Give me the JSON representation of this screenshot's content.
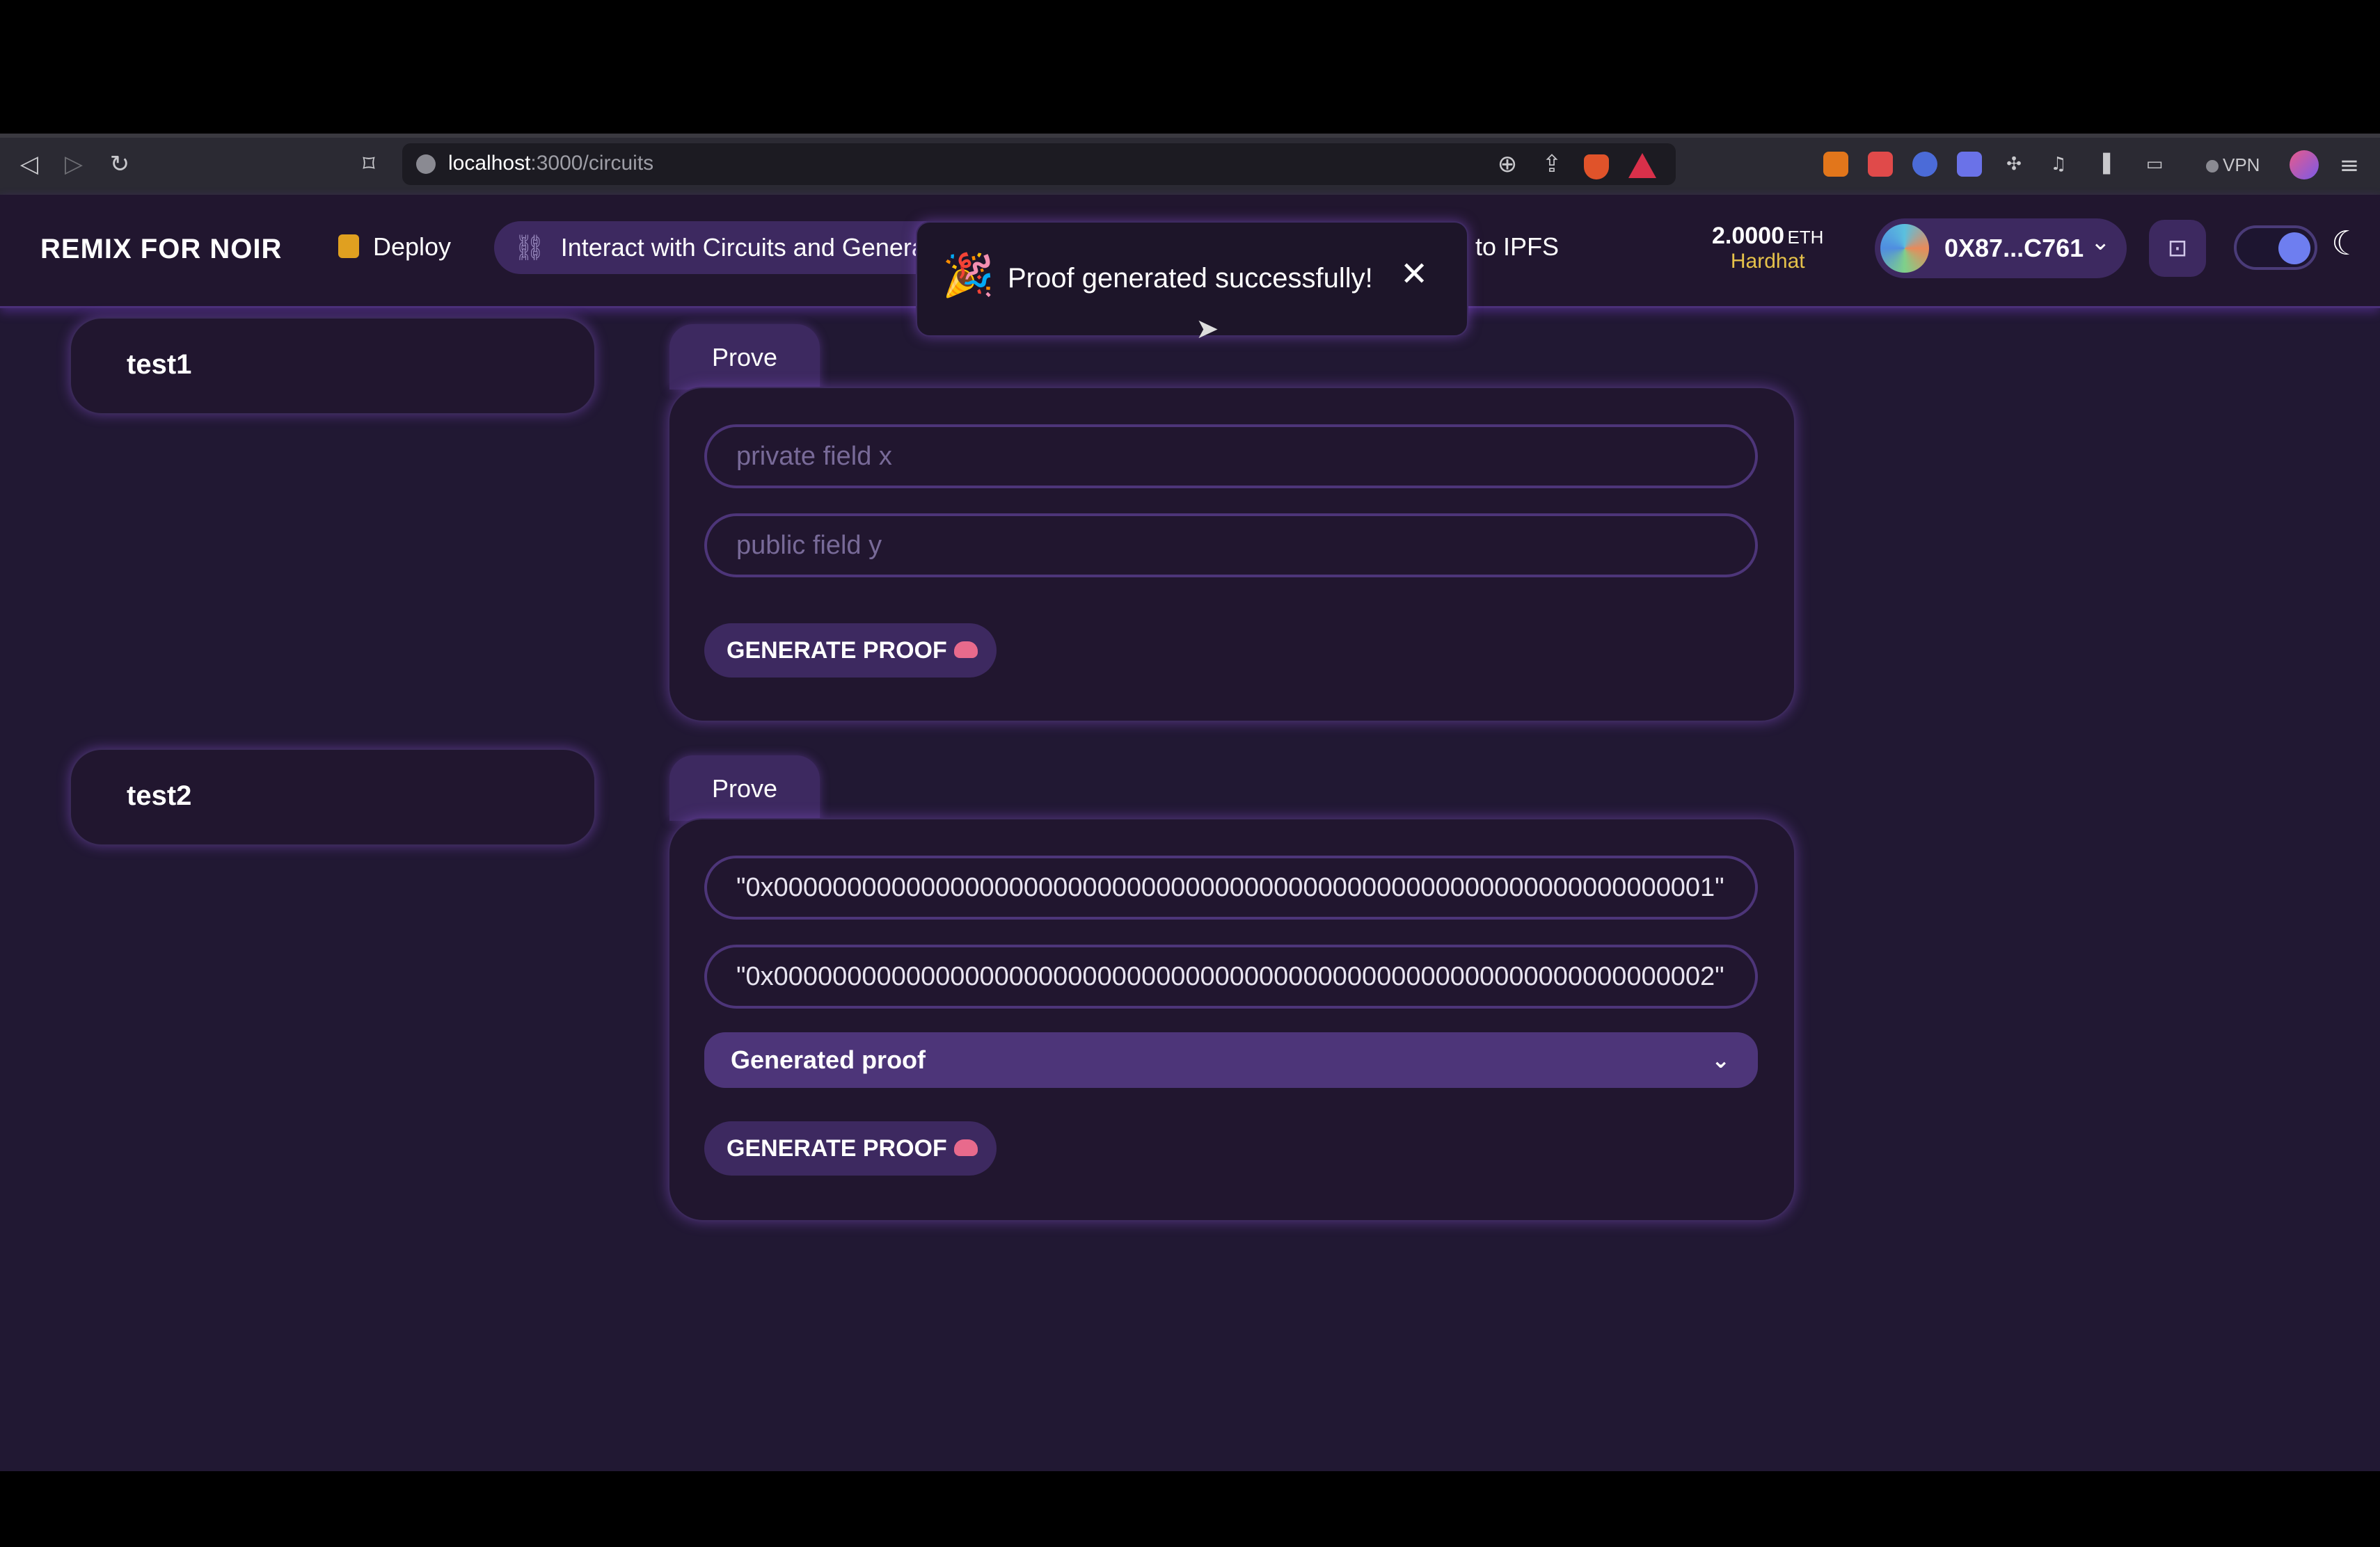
{
  "browser": {
    "back_icon": "◁",
    "forward_icon": "▷",
    "reload_icon": "↻",
    "bookmark_icon": "⌑",
    "url_host": "localhost",
    "url_path": ":3000/circuits",
    "zoom_icon": "⊕",
    "share_icon": "⇪",
    "vpn_label": "VPN",
    "menu_icon": "≡"
  },
  "navbar": {
    "brand": "REMIX FOR NOIR",
    "deploy_label": "Deploy",
    "interact_label": "Interact with Circuits and Generate Proofs",
    "interact_icon": "⛓",
    "ipfs_label": "d to IPFS",
    "balance_amount": "2.0000",
    "balance_unit": "ETH",
    "network": "Hardhat",
    "wallet_address": "0X87...C761",
    "wallet_chevron": "⌄",
    "qr_icon": "⊡",
    "moon_icon": "☾"
  },
  "toast": {
    "icon": "🎉",
    "message": "Proof generated successfully!",
    "close_icon": "✕"
  },
  "cursor_icon": "➤",
  "circuits": [
    {
      "name": "test1",
      "tab_label": "Prove",
      "inputs": [
        {
          "placeholder": "private field x",
          "value": ""
        },
        {
          "placeholder": "public field y",
          "value": ""
        }
      ],
      "button_label": "GENERATE PROOF"
    },
    {
      "name": "test2",
      "tab_label": "Prove",
      "inputs": [
        {
          "placeholder": "",
          "value": "\"0x0000000000000000000000000000000000000000000000000000000000000001\""
        },
        {
          "placeholder": "",
          "value": "\"0x0000000000000000000000000000000000000000000000000000000000000002\""
        }
      ],
      "accordion_label": "Generated proof",
      "accordion_chevron": "⌄",
      "button_label": "GENERATE PROOF"
    }
  ],
  "colors": {
    "background": "#211833",
    "accent": "#3d2960",
    "border": "#4d3579",
    "network": "#e6c24a",
    "toggle_knob": "#6e7ef0"
  }
}
